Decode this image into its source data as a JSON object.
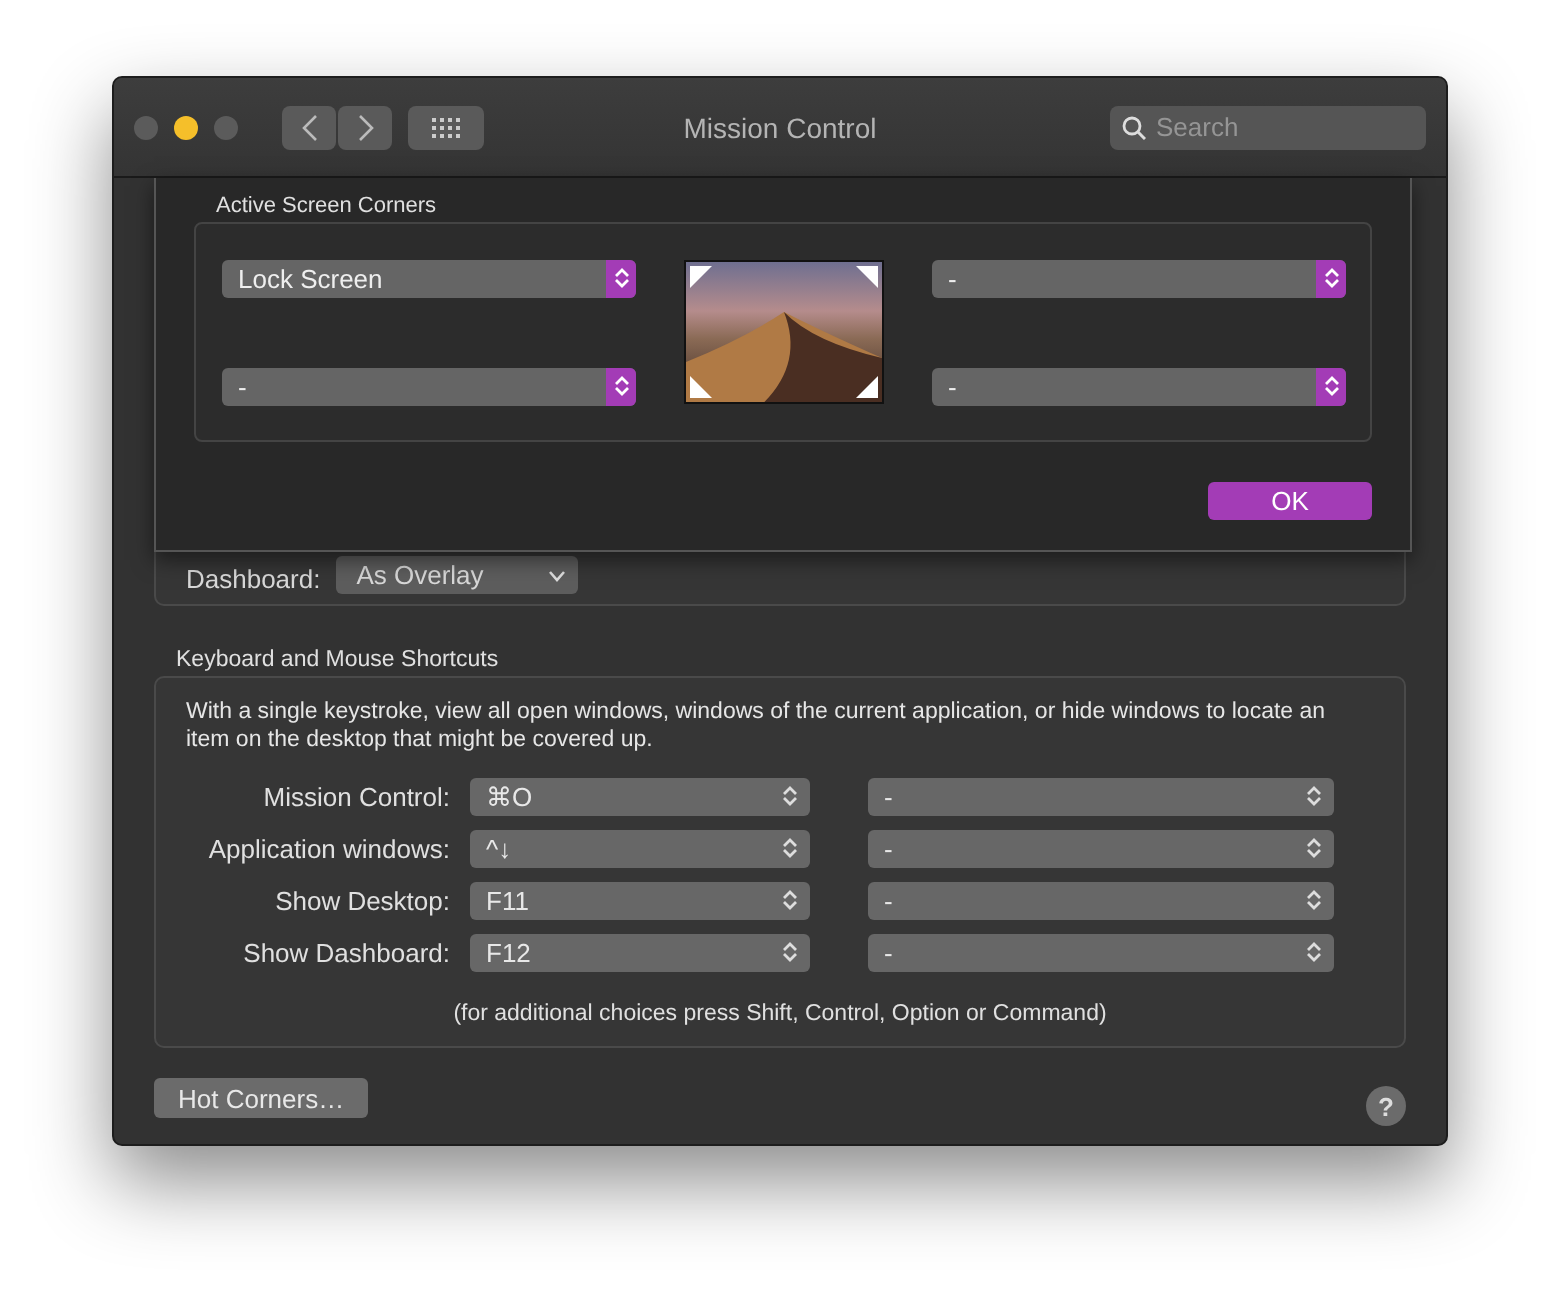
{
  "window": {
    "title": "Mission Control"
  },
  "search": {
    "placeholder": "Search"
  },
  "sheet": {
    "title": "Active Screen Corners",
    "corners": [
      {
        "value": "Lock Screen"
      },
      {
        "value": "-"
      },
      {
        "value": "-"
      },
      {
        "value": "-"
      }
    ],
    "ok": "OK"
  },
  "dashboard": {
    "label": "Dashboard:",
    "value": "As Overlay"
  },
  "shortcuts": {
    "title": "Keyboard and Mouse Shortcuts",
    "description": "With a single keystroke, view all open windows, windows of the current application, or hide windows to locate an item on the desktop that might be covered up.",
    "rows": [
      {
        "label": "Mission Control:",
        "primary": "⌘O",
        "secondary": "-"
      },
      {
        "label": "Application windows:",
        "primary": "^↓",
        "secondary": "-"
      },
      {
        "label": "Show Desktop:",
        "primary": "F11",
        "secondary": "-"
      },
      {
        "label": "Show Dashboard:",
        "primary": "F12",
        "secondary": "-"
      }
    ],
    "note": "(for additional choices press Shift, Control, Option or Command)"
  },
  "hot_corners": "Hot Corners…",
  "help": "?"
}
